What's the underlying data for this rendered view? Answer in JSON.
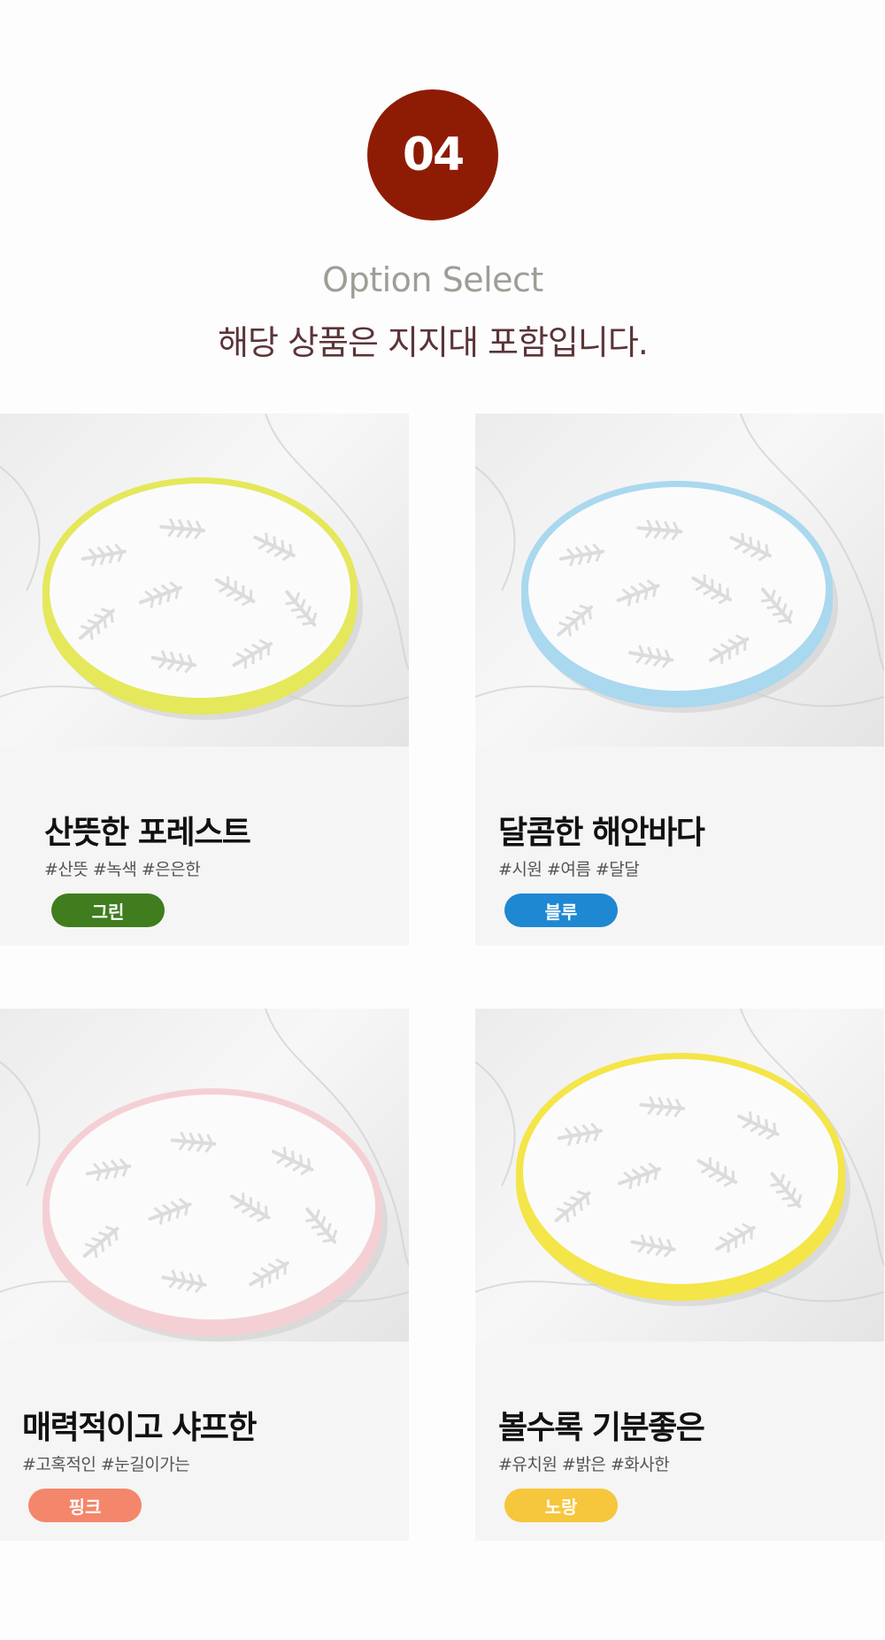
{
  "step": {
    "number": "04"
  },
  "heading": {
    "subtitle": "Option Select",
    "title": "해당 상품은 지지대 포함입니다."
  },
  "options": [
    {
      "title": "산뜻한 포레스트",
      "tags": "#산뜻 #녹색 #은은한",
      "color_label": "그린",
      "chip_color": "#3f7d1f",
      "rim_color": "#e4e85a",
      "image_icon": "plate-photo"
    },
    {
      "title": "달콤한 해안바다",
      "tags": "#시원 #여름 #달달",
      "color_label": "블루",
      "chip_color": "#1e88d2",
      "rim_color": "#a9d8ef",
      "image_icon": "plate-photo"
    },
    {
      "title": "매력적이고 샤프한",
      "tags": "#고혹적인 #눈길이가는",
      "color_label": "핑크",
      "chip_color": "#f4866b",
      "rim_color": "#f4d0d4",
      "image_icon": "plate-photo"
    },
    {
      "title": "볼수록 기분좋은",
      "tags": "#유치원 #밝은 #화사한",
      "color_label": "노랑",
      "chip_color": "#f6c63c",
      "rim_color": "#f4e548",
      "image_icon": "plate-photo"
    }
  ]
}
